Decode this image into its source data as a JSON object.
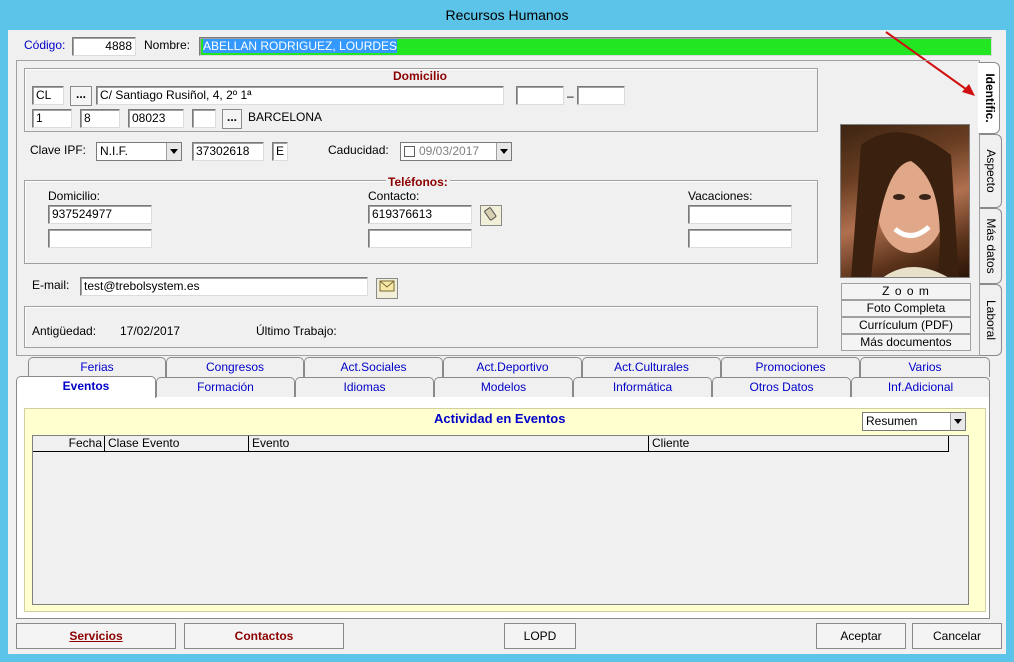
{
  "window": {
    "title": "Recursos Humanos"
  },
  "header": {
    "codigo_label": "Código:",
    "codigo_value": "4888",
    "nombre_label": "Nombre:",
    "nombre_value": "ABELLAN RODRIGUEZ, LOURDES"
  },
  "domicilio": {
    "title": "Domicilio",
    "via_tipo": "CL",
    "ellipsis": "...",
    "direccion": "C/ Santiago Rusiñol, 4, 2º 1ª",
    "dash": "–",
    "num1": "1",
    "num2": "8",
    "cp": "08023",
    "ciudad": "BARCELONA"
  },
  "ident": {
    "clave_label": "Clave IPF:",
    "tipo_doc": "N.I.F.",
    "numero": "37302618",
    "letra": "E",
    "caducidad_label": "Caducidad:",
    "caducidad_value": "09/03/2017"
  },
  "telefonos": {
    "title": "Teléfonos:",
    "domicilio_label": "Domicilio:",
    "domicilio_value": "937524977",
    "contacto_label": "Contacto:",
    "contacto_value": "619376613",
    "vacaciones_label": "Vacaciones:"
  },
  "email": {
    "label": "E-mail:",
    "value": "test@trebolsystem.es"
  },
  "antiguedad": {
    "label": "Antigüedad:",
    "value": "17/02/2017",
    "ultimo_label": "Último Trabajo:"
  },
  "photo_buttons": [
    "Z o o m",
    "Foto Completa",
    "Currículum (PDF)",
    "Más documentos"
  ],
  "side_tabs": [
    "Identific.",
    "Aspecto",
    "Más datos",
    "Laboral"
  ],
  "tabs_row1": [
    "Ferias",
    "Congresos",
    "Act.Sociales",
    "Act.Deportivo",
    "Act.Culturales",
    "Promociones",
    "Varios"
  ],
  "tabs_row2": [
    "Eventos",
    "Formación",
    "Idiomas",
    "Modelos",
    "Informática",
    "Otros Datos",
    "Inf.Adicional"
  ],
  "eventos": {
    "title": "Actividad en Eventos",
    "view_select": "Resumen",
    "columns": [
      "Fecha",
      "Clase Evento",
      "Evento",
      "Cliente"
    ]
  },
  "footer": {
    "servicios": "Servicios",
    "contactos": "Contactos",
    "lopd": "LOPD",
    "aceptar": "Aceptar",
    "cancelar": "Cancelar"
  },
  "colors": {
    "name_field": "#22e622",
    "accent_blue": "#0000c8",
    "group_title": "#8b0000",
    "panel_yellow": "#ffffd0"
  }
}
